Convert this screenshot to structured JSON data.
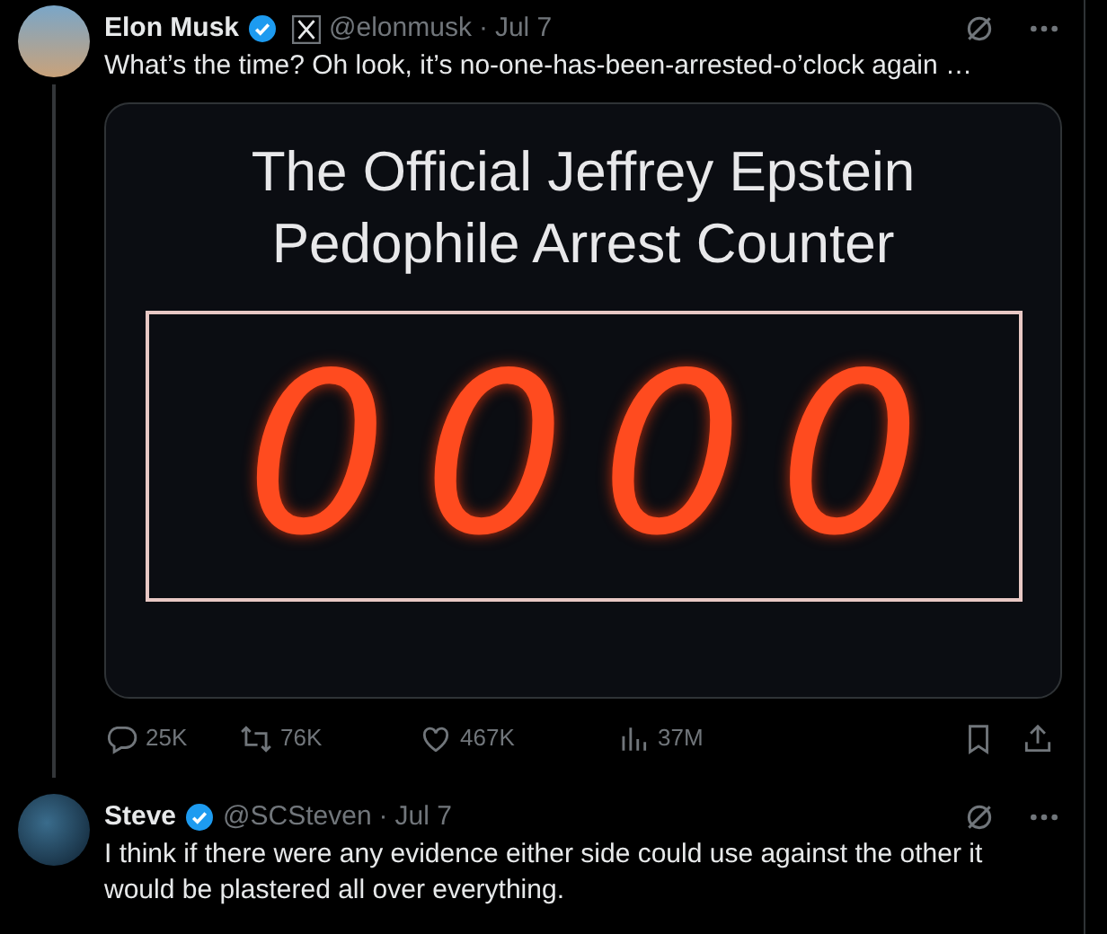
{
  "tweets": [
    {
      "name": "Elon Musk",
      "verified": true,
      "affiliate_badge": true,
      "handle": "@elonmusk",
      "separator": "·",
      "date": "Jul 7",
      "text": "What’s the time? Oh look, it’s no-one-has-been-arrested-o’clock again …",
      "thread_line": true,
      "media": {
        "title": "The Official Jeffrey Epstein Pedophile Arrest Counter",
        "counter": "0000"
      },
      "actions": [
        {
          "kind": "reply",
          "count": "25K"
        },
        {
          "kind": "repost",
          "count": "76K"
        },
        {
          "kind": "like",
          "count": "467K"
        },
        {
          "kind": "views",
          "count": "37M"
        },
        {
          "kind": "bookmark"
        },
        {
          "kind": "share"
        }
      ]
    },
    {
      "name": "Steve",
      "verified": true,
      "affiliate_badge": false,
      "handle": "@SCSteven",
      "separator": "·",
      "date": "Jul 7",
      "text": "I think if there were any evidence either side could use against the other it would be plastered all over everything.",
      "thread_line": false
    }
  ]
}
